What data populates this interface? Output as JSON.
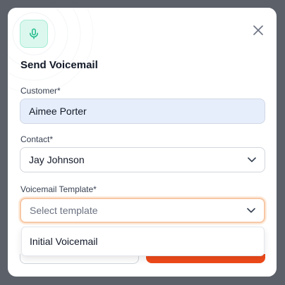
{
  "modal": {
    "title": "Send Voicemail",
    "icon": "microphone-icon",
    "close_icon": "close-icon"
  },
  "fields": {
    "customer": {
      "label": "Customer*",
      "value": "Aimee Porter"
    },
    "contact": {
      "label": "Contact*",
      "value": "Jay Johnson"
    },
    "template": {
      "label": "Voicemail Template*",
      "placeholder": "Select template"
    }
  },
  "dropdown": {
    "options": [
      "Initial Voicemail"
    ]
  },
  "colors": {
    "accent": "#ef4a1a",
    "icon_green": "#1fb98a",
    "readonly_bg": "#e7eefb",
    "focus_ring": "#f7c8a6"
  }
}
